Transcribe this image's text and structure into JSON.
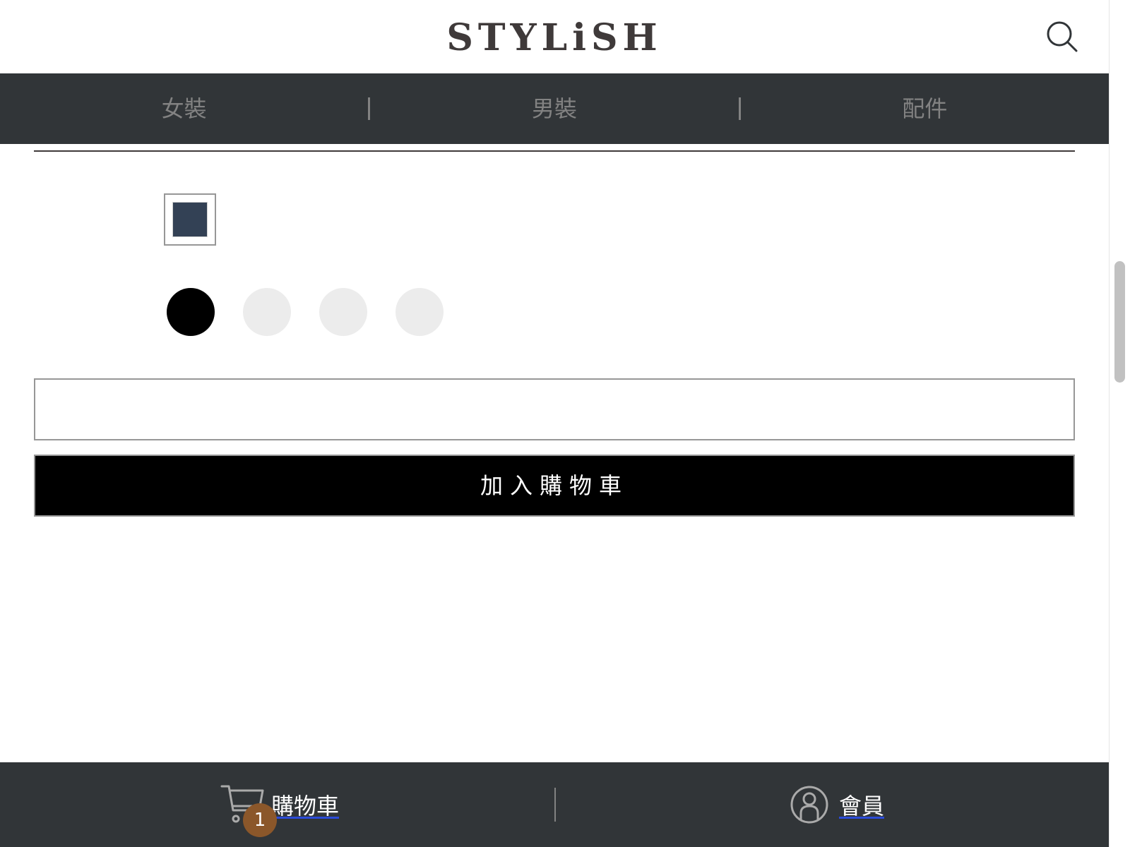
{
  "header": {
    "logo_text": "STYLiSH",
    "search_icon": "search-icon"
  },
  "categories": [
    {
      "label": "女裝"
    },
    {
      "label": "男裝"
    },
    {
      "label": "配件"
    }
  ],
  "product": {
    "selected_color": "#334155",
    "size_selected_index": 0,
    "size_colors": {
      "selected": "#000000",
      "unselected": "#ececec"
    },
    "quantity_value": "",
    "add_to_cart_label": "加入購物車"
  },
  "bottom_bar": {
    "cart_label": "購物車",
    "cart_count": "1",
    "cart_icon": "cart-icon",
    "member_label": "會員",
    "member_icon": "member-icon"
  },
  "colors": {
    "nav_bg": "#313538",
    "nav_text": "#828282",
    "badge": "#8b572a",
    "brand_text": "#3f3a3a"
  }
}
